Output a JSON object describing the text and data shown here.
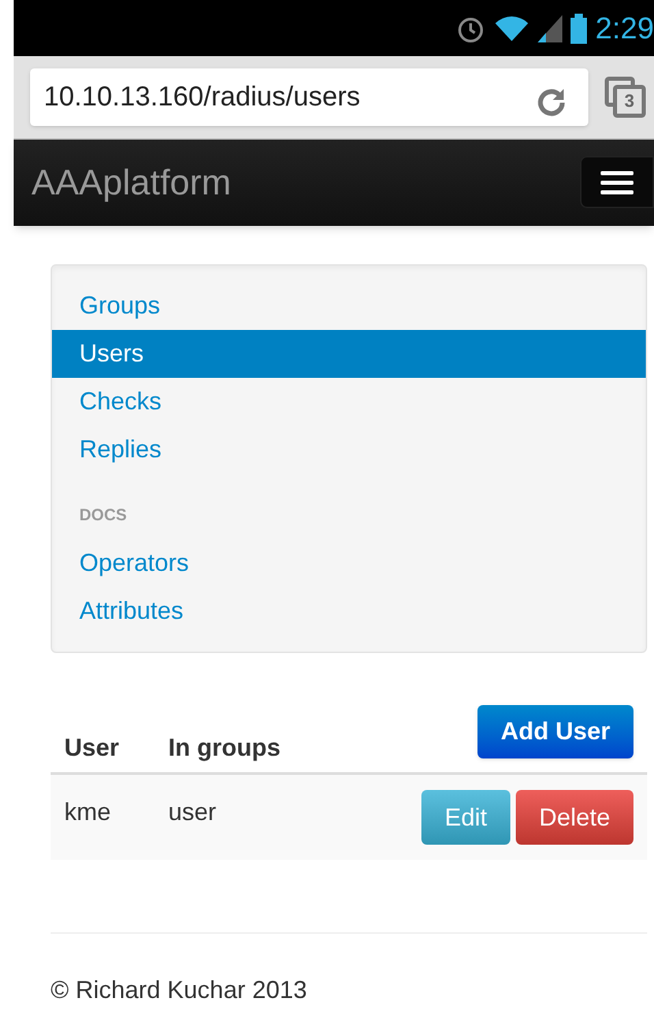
{
  "status_bar": {
    "time": "2:29"
  },
  "browser": {
    "url": "10.10.13.160/radius/users",
    "tab_count": "3"
  },
  "navbar": {
    "brand": "AAAplatform"
  },
  "sidebar": {
    "items": [
      {
        "kind": "link",
        "label": "Groups",
        "selected": false
      },
      {
        "kind": "link",
        "label": "Users",
        "selected": true
      },
      {
        "kind": "link",
        "label": "Checks",
        "selected": false
      },
      {
        "kind": "link",
        "label": "Replies",
        "selected": false
      },
      {
        "kind": "header",
        "label": "DOCS"
      },
      {
        "kind": "link",
        "label": "Operators",
        "selected": false
      },
      {
        "kind": "link",
        "label": "Attributes",
        "selected": false
      }
    ]
  },
  "table": {
    "columns": [
      "User",
      "In groups"
    ],
    "add_button": "Add User",
    "rows": [
      {
        "user": "kme",
        "groups": "user",
        "actions": [
          "Edit",
          "Delete"
        ]
      }
    ]
  },
  "footer": "© Richard Kuchar 2013"
}
